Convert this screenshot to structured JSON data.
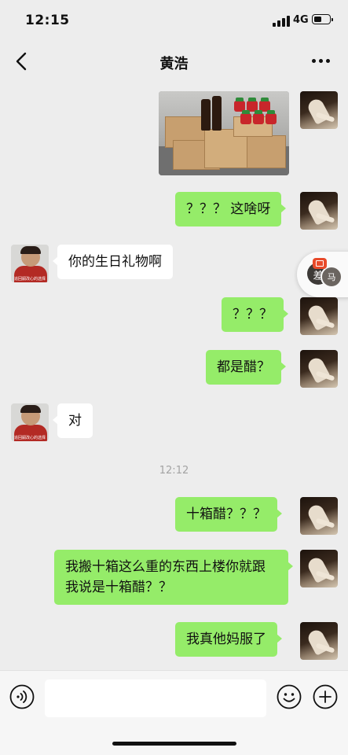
{
  "status_bar": {
    "time": "12:15",
    "network": "4G",
    "battery_level": 0.55
  },
  "header": {
    "title": "黄浩"
  },
  "messages": [
    {
      "sender": "me",
      "kind": "image"
    },
    {
      "sender": "me",
      "text": "？？？ 这啥呀"
    },
    {
      "sender": "other",
      "text": "你的生日礼物啊"
    },
    {
      "sender": "me",
      "text": "？？？"
    },
    {
      "sender": "me",
      "text": "都是醋？"
    },
    {
      "sender": "other",
      "text": "对"
    },
    {
      "sender": "me",
      "text": "十箱醋？？？"
    },
    {
      "sender": "me",
      "text": "我搬十箱这么重的东西上楼你就跟我说是十箱醋？？"
    },
    {
      "sender": "me",
      "text": "我真他妈服了"
    }
  ],
  "timestamp": "12:12",
  "friend_avatar_caption": "追回嗣改心的选择",
  "floating_widget": {
    "icon_a_text": "差",
    "icon_b_text": "马"
  },
  "input": {
    "value": "",
    "placeholder": ""
  },
  "colors": {
    "my_bubble": "#95ec69",
    "their_bubble": "#ffffff",
    "background": "#ededed"
  }
}
